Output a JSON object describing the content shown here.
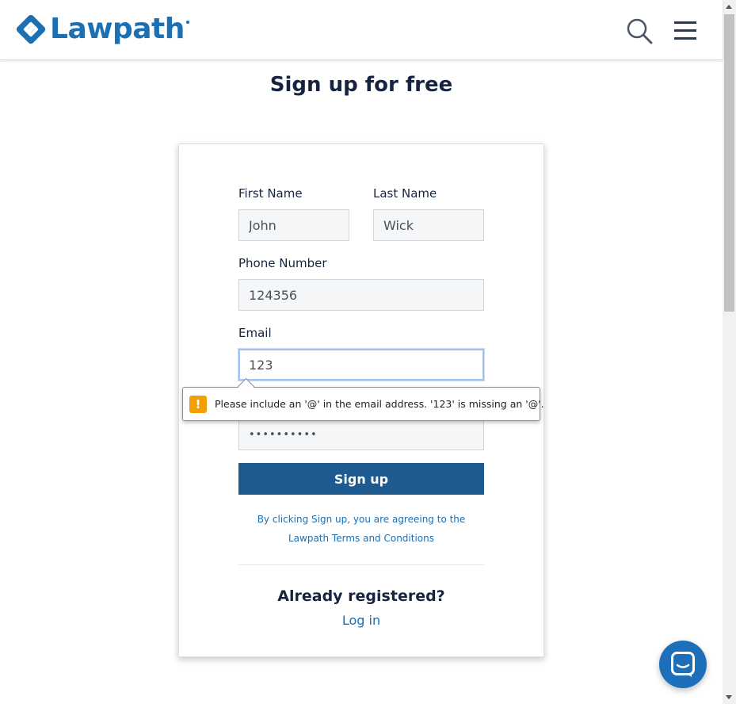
{
  "header": {
    "logo_text": "Lawpath",
    "search_icon": "search-icon",
    "menu_icon": "hamburger-menu-icon"
  },
  "page": {
    "title": "Sign up for free"
  },
  "form": {
    "first_name": {
      "label": "First Name",
      "value": "John"
    },
    "last_name": {
      "label": "Last Name",
      "value": "Wick"
    },
    "phone": {
      "label": "Phone Number",
      "value": "124356"
    },
    "email": {
      "label": "Email",
      "value": "123"
    },
    "password": {
      "value": "••••••••••"
    },
    "submit_label": "Sign up",
    "terms_line1": "By clicking Sign up, you are agreeing to the",
    "terms_link": "Lawpath Terms and Conditions"
  },
  "validation_tooltip": {
    "icon": "warning-icon",
    "icon_glyph": "!",
    "message": "Please include an '@' in the email address. '123' is missing an '@'."
  },
  "footer": {
    "already_registered": "Already registered?",
    "login_label": "Log in"
  },
  "chat": {
    "icon": "chat-icon"
  },
  "colors": {
    "brand_blue": "#1b6fb3",
    "button_blue": "#1c5a8f",
    "heading": "#172440",
    "warning": "#f0a000"
  }
}
